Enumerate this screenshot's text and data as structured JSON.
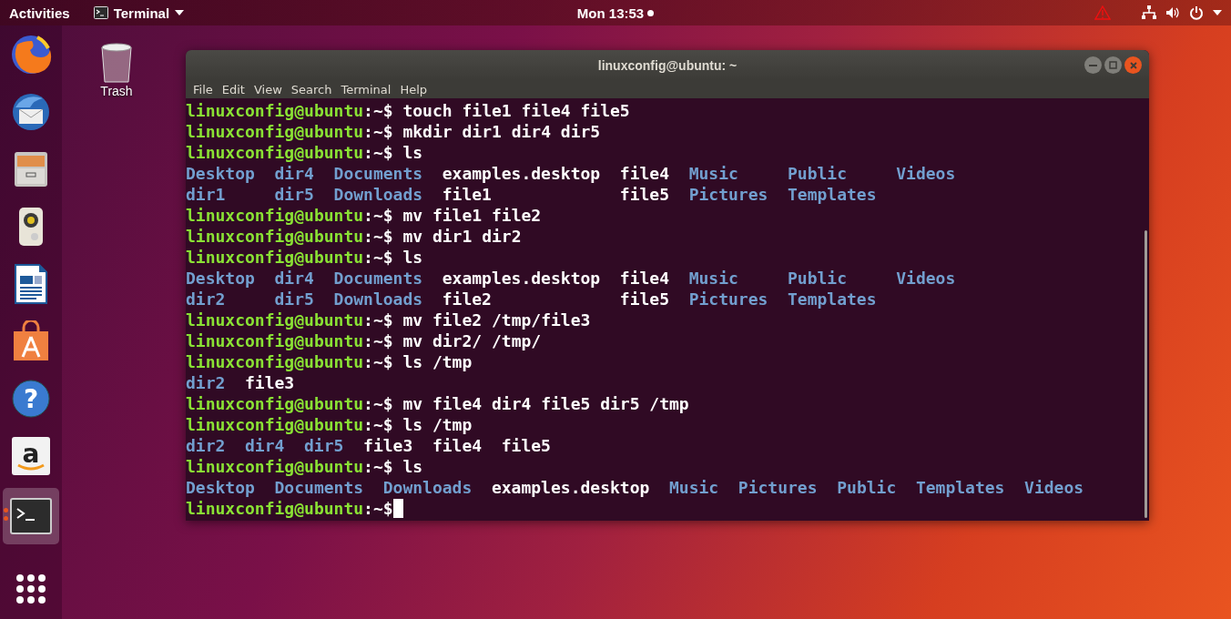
{
  "top_bar": {
    "activities": "Activities",
    "app_menu": "Terminal",
    "clock": "Mon 13:53",
    "notification": true
  },
  "dock": [
    {
      "kind": "browser",
      "active": false,
      "running": false
    },
    {
      "kind": "mail",
      "active": false,
      "running": false
    },
    {
      "kind": "files",
      "active": false,
      "running": false
    },
    {
      "kind": "music",
      "active": false,
      "running": false
    },
    {
      "kind": "writer",
      "active": false,
      "running": false
    },
    {
      "kind": "software",
      "active": false,
      "running": false
    },
    {
      "kind": "help",
      "glyph": "?",
      "active": false,
      "running": false
    },
    {
      "kind": "shop",
      "glyph": "a",
      "active": false,
      "running": false
    },
    {
      "kind": "terminal",
      "active": true,
      "running": true
    },
    {
      "kind": "apps",
      "active": false,
      "running": false
    }
  ],
  "desktop_icons": [
    {
      "label": "Trash"
    }
  ],
  "window": {
    "title": "linuxconfig@ubuntu: ~",
    "menu": [
      "File",
      "Edit",
      "View",
      "Search",
      "Terminal",
      "Help"
    ],
    "lines": [
      {
        "kind": "prompt",
        "user": "linuxconfig@ubuntu",
        "path": ":~$",
        "command": "touch file1 file4 file5",
        "cursor": false
      },
      {
        "kind": "prompt",
        "user": "linuxconfig@ubuntu",
        "path": ":~$",
        "command": "mkdir dir1 dir4 dir5",
        "cursor": false
      },
      {
        "kind": "prompt",
        "user": "linuxconfig@ubuntu",
        "path": ":~$",
        "command": "ls",
        "cursor": false
      },
      {
        "kind": "listing",
        "rows": [
          [
            {
              "name": "Desktop",
              "kind": "dir"
            },
            {
              "name": "dir4",
              "kind": "dir"
            },
            {
              "name": "Documents",
              "kind": "dir"
            },
            {
              "name": "examples.desktop",
              "kind": "file"
            },
            {
              "name": "file4",
              "kind": "file"
            },
            {
              "name": "Music",
              "kind": "dir"
            },
            {
              "name": "Public",
              "kind": "dir"
            },
            {
              "name": "Videos",
              "kind": "dir"
            }
          ],
          [
            {
              "name": "dir1",
              "kind": "dir"
            },
            {
              "name": "dir5",
              "kind": "dir"
            },
            {
              "name": "Downloads",
              "kind": "dir"
            },
            {
              "name": "file1",
              "kind": "file"
            },
            {
              "name": "file5",
              "kind": "file"
            },
            {
              "name": "Pictures",
              "kind": "dir"
            },
            {
              "name": "Templates",
              "kind": "dir"
            }
          ]
        ]
      },
      {
        "kind": "prompt",
        "user": "linuxconfig@ubuntu",
        "path": ":~$",
        "command": "mv file1 file2",
        "cursor": false
      },
      {
        "kind": "prompt",
        "user": "linuxconfig@ubuntu",
        "path": ":~$",
        "command": "mv dir1 dir2",
        "cursor": false
      },
      {
        "kind": "prompt",
        "user": "linuxconfig@ubuntu",
        "path": ":~$",
        "command": "ls",
        "cursor": false
      },
      {
        "kind": "listing",
        "rows": [
          [
            {
              "name": "Desktop",
              "kind": "dir"
            },
            {
              "name": "dir4",
              "kind": "dir"
            },
            {
              "name": "Documents",
              "kind": "dir"
            },
            {
              "name": "examples.desktop",
              "kind": "file"
            },
            {
              "name": "file4",
              "kind": "file"
            },
            {
              "name": "Music",
              "kind": "dir"
            },
            {
              "name": "Public",
              "kind": "dir"
            },
            {
              "name": "Videos",
              "kind": "dir"
            }
          ],
          [
            {
              "name": "dir2",
              "kind": "dir"
            },
            {
              "name": "dir5",
              "kind": "dir"
            },
            {
              "name": "Downloads",
              "kind": "dir"
            },
            {
              "name": "file2",
              "kind": "file"
            },
            {
              "name": "file5",
              "kind": "file"
            },
            {
              "name": "Pictures",
              "kind": "dir"
            },
            {
              "name": "Templates",
              "kind": "dir"
            }
          ]
        ]
      },
      {
        "kind": "prompt",
        "user": "linuxconfig@ubuntu",
        "path": ":~$",
        "command": "mv file2 /tmp/file3",
        "cursor": false
      },
      {
        "kind": "prompt",
        "user": "linuxconfig@ubuntu",
        "path": ":~$",
        "command": "mv dir2/ /tmp/",
        "cursor": false
      },
      {
        "kind": "prompt",
        "user": "linuxconfig@ubuntu",
        "path": ":~$",
        "command": "ls /tmp",
        "cursor": false
      },
      {
        "kind": "listing",
        "rows": [
          [
            {
              "name": "dir2",
              "kind": "dir"
            },
            {
              "name": "file3",
              "kind": "file"
            }
          ]
        ]
      },
      {
        "kind": "prompt",
        "user": "linuxconfig@ubuntu",
        "path": ":~$",
        "command": "mv file4 dir4 file5 dir5 /tmp",
        "cursor": false
      },
      {
        "kind": "prompt",
        "user": "linuxconfig@ubuntu",
        "path": ":~$",
        "command": "ls /tmp",
        "cursor": false
      },
      {
        "kind": "listing",
        "rows": [
          [
            {
              "name": "dir2",
              "kind": "dir"
            },
            {
              "name": "dir4",
              "kind": "dir"
            },
            {
              "name": "dir5",
              "kind": "dir"
            },
            {
              "name": "file3",
              "kind": "file"
            },
            {
              "name": "file4",
              "kind": "file"
            },
            {
              "name": "file5",
              "kind": "file"
            }
          ]
        ]
      },
      {
        "kind": "prompt",
        "user": "linuxconfig@ubuntu",
        "path": ":~$",
        "command": "ls",
        "cursor": false
      },
      {
        "kind": "listing",
        "rows": [
          [
            {
              "name": "Desktop",
              "kind": "dir"
            },
            {
              "name": "Documents",
              "kind": "dir"
            },
            {
              "name": "Downloads",
              "kind": "dir"
            },
            {
              "name": "examples.desktop",
              "kind": "file"
            },
            {
              "name": "Music",
              "kind": "dir"
            },
            {
              "name": "Pictures",
              "kind": "dir"
            },
            {
              "name": "Public",
              "kind": "dir"
            },
            {
              "name": "Templates",
              "kind": "dir"
            },
            {
              "name": "Videos",
              "kind": "dir"
            }
          ]
        ]
      },
      {
        "kind": "prompt",
        "user": "linuxconfig@ubuntu",
        "path": ":~$",
        "cursor": true
      }
    ]
  }
}
